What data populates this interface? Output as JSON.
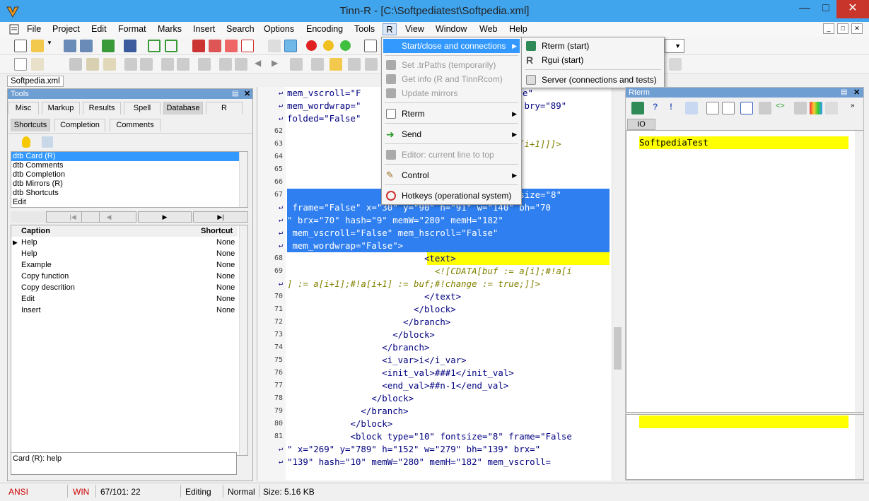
{
  "window": {
    "title": "Tinn-R - [C:\\Softpediatest\\Softpedia.xml]"
  },
  "menubar": [
    "File",
    "Project",
    "Edit",
    "Format",
    "Marks",
    "Insert",
    "Search",
    "Options",
    "Encoding",
    "Tools",
    "R",
    "View",
    "Window",
    "Web",
    "Help"
  ],
  "document_tab": "Softpedia.xml",
  "tools_panel": {
    "title": "Tools",
    "tabs": [
      "Misc",
      "Markup",
      "Results",
      "Spell",
      "Database",
      "R"
    ],
    "subtabs": [
      "Shortcuts",
      "Completion",
      "Comments"
    ],
    "list": [
      "dtb Card (R)",
      "dtb Comments",
      "dtb Completion",
      "dtb Mirrors (R)",
      "dtb Shortcuts",
      "Edit"
    ],
    "grid_headers": {
      "caption": "Caption",
      "shortcut": "Shortcut"
    },
    "grid_rows": [
      {
        "caption": "Help",
        "shortcut": "None"
      },
      {
        "caption": "Help",
        "shortcut": "None"
      },
      {
        "caption": "Example",
        "shortcut": "None"
      },
      {
        "caption": "Copy function",
        "shortcut": "None"
      },
      {
        "caption": "Copy descrition",
        "shortcut": "None"
      },
      {
        "caption": "Edit",
        "shortcut": "None"
      },
      {
        "caption": "Insert",
        "shortcut": "None"
      }
    ],
    "card_text": "Card (R): help"
  },
  "editor": {
    "lines": [
      {
        "n": "",
        "t": "mem_vscroll=\"F"
      },
      {
        "n": "",
        "t": "mem_wordwrap=\""
      },
      {
        "n": "",
        "t": "folded=\"False\""
      },
      {
        "n": "62",
        "t": ""
      },
      {
        "n": "63",
        "t": ""
      },
      {
        "n": "64",
        "t": ""
      },
      {
        "n": "65",
        "t": ""
      },
      {
        "n": "66",
        "t": ""
      },
      {
        "n": "67",
        "t": "                        <block type=\"2\" fontsize=\"8\""
      },
      {
        "n": "",
        "t": " frame=\"False\" x=\"30\" y=\"90\" h=\"91\" w=\"140\" bh=\"70"
      },
      {
        "n": "",
        "t": "\" brx=\"70\" hash=\"9\" memW=\"280\" memH=\"182\""
      },
      {
        "n": "",
        "t": " mem_vscroll=\"False\" mem_hscroll=\"False\""
      },
      {
        "n": "",
        "t": " mem_wordwrap=\"False\">"
      },
      {
        "n": "68",
        "t": "                          <text>"
      },
      {
        "n": "69",
        "t": "                            <![CDATA[buf := a[i];#!a[i"
      },
      {
        "n": "",
        "t": "] := a[i+1];#!a[i+1] := buf;#!change := true;]]>"
      },
      {
        "n": "70",
        "t": "                          </text>"
      },
      {
        "n": "71",
        "t": "                        </block>"
      },
      {
        "n": "72",
        "t": "                      </branch>"
      },
      {
        "n": "73",
        "t": "                    </block>"
      },
      {
        "n": "74",
        "t": "                  </branch>"
      },
      {
        "n": "75",
        "t": "                  <i_var>i</i_var>"
      },
      {
        "n": "76",
        "t": "                  <init_val>###1</init_val>"
      },
      {
        "n": "77",
        "t": "                  <end_val>##n-1</end_val>"
      },
      {
        "n": "78",
        "t": "                </block>"
      },
      {
        "n": "79",
        "t": "              </branch>"
      },
      {
        "n": "80",
        "t": "            </block>"
      },
      {
        "n": "81",
        "t": "            <block type=\"10\" fontsize=\"8\" frame=\"False"
      },
      {
        "n": "",
        "t": "\" x=\"269\" y=\"789\" h=\"152\" w=\"279\" bh=\"139\" brx=\""
      },
      {
        "n": "",
        "t": "\"139\" hash=\"10\" memW=\"280\" memH=\"182\" mem_vscroll="
      }
    ],
    "partial_right": [
      " bry=\"89\"",
      "[i+1]]]>",
      "e\""
    ]
  },
  "r_menu": {
    "items": [
      {
        "label": "Start/close and connections",
        "state": "hover",
        "arrow": true
      },
      {
        "label": "Set .trPaths (temporarily)",
        "state": "disabled",
        "arrow": false
      },
      {
        "label": "Get info (R and TinnRcom)",
        "state": "disabled",
        "arrow": false
      },
      {
        "label": "Update mirrors",
        "state": "disabled",
        "arrow": false
      },
      {
        "label": "Rterm",
        "state": "normal",
        "arrow": true
      },
      {
        "label": "Send",
        "state": "normal",
        "arrow": true
      },
      {
        "label": "Editor: current line to top",
        "state": "disabled",
        "arrow": false
      },
      {
        "label": "Control",
        "state": "normal",
        "arrow": true
      },
      {
        "label": "Hotkeys (operational system)",
        "state": "normal",
        "arrow": false
      }
    ],
    "submenu": [
      "Rterm (start)",
      "Rgui (start)",
      "Server (connections and tests)"
    ]
  },
  "rterm_panel": {
    "title": "Rterm",
    "tab": "IO",
    "output": "SoftpediaTest"
  },
  "statusbar": {
    "encoding": "ANSI",
    "eol": "WIN",
    "position": "67/101: 22",
    "mode": "Editing",
    "view": "Normal",
    "size": "Size: 5.16 KB"
  },
  "colors": {
    "titlebar": "#41a5ee",
    "panel_header": "#6f9ed3",
    "selection": "#2f7ff0",
    "highlight": "#ffff00",
    "menu_hover": "#3399ff"
  }
}
